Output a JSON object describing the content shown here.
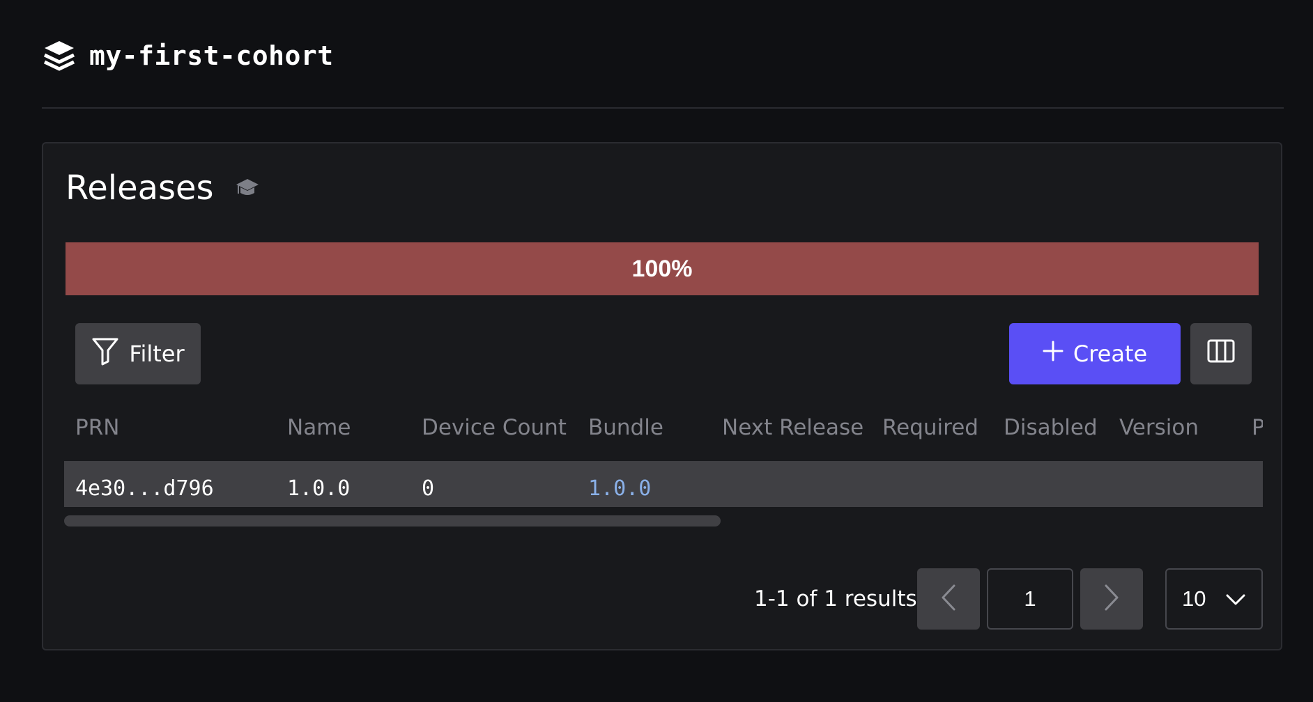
{
  "header": {
    "title": "my-first-cohort",
    "icon": "stack-icon"
  },
  "panel": {
    "title": "Releases",
    "title_icon": "graduation-cap-icon",
    "progress": {
      "label": "100%",
      "value": 1.0,
      "color": "#944a49"
    }
  },
  "toolbar": {
    "filter_label": "Filter",
    "create_label": "Create",
    "columns_icon": "columns-icon"
  },
  "table": {
    "columns": [
      "PRN",
      "Name",
      "Device Count",
      "Bundle",
      "Next Release",
      "Required",
      "Disabled",
      "Version",
      "P"
    ],
    "rows": [
      {
        "prn": "4e30...d796",
        "name": "1.0.0",
        "device_count": "0",
        "bundle": "1.0.0"
      }
    ]
  },
  "pagination": {
    "results": "1-1 of 1 results",
    "page": "1",
    "page_size": "10"
  },
  "colors": {
    "accent": "#5a4ff5",
    "link": "#8ab0e8",
    "progress": "#944a49",
    "background": "#0f1013"
  }
}
